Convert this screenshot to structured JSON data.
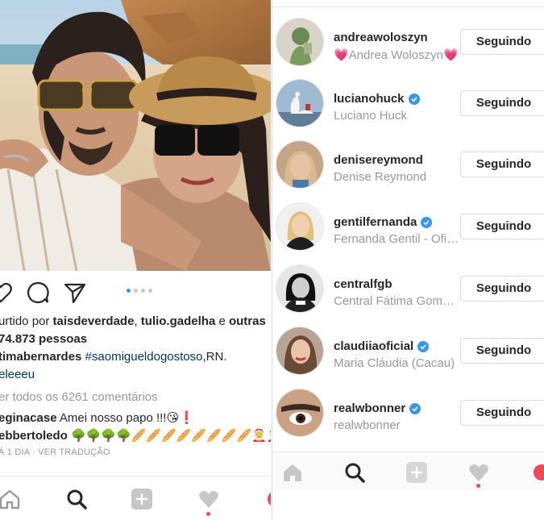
{
  "post": {
    "liked_prefix": "urtido por ",
    "liked_user1": "taisdeverdade",
    "liked_sep": ", ",
    "liked_user2": "tulio.gadelha",
    "liked_and": " e ",
    "liked_others": "outras",
    "likes_count": "74.873 pessoas",
    "caption_user": "tima­bernardes",
    "caption_hashtag": "#saomigueldogostoso",
    "caption_rest": ",RN.",
    "caption_line2": "eleeeu",
    "view_comments": "er todos os 6261 comentários",
    "comment1_user": "eginacase",
    "comment1_text": " Amei nosso papo !!!😘❗",
    "comment2_user": "ebbertoledo",
    "comment2_text": " 🌳🌳🌳🌳🥖🥖🥖🥖🥖🥖🥖🥖🤶🤶🤶🤶",
    "meta_time": "Á 1 DIA",
    "meta_sep": " · ",
    "meta_translate": "VER TRADUÇÃO",
    "carousel": {
      "total": 4,
      "active": 1
    }
  },
  "following": [
    {
      "username": "andreawoloszyn",
      "fullname": "💗Andrea Woloszyn💗",
      "verified": false,
      "button": "Seguindo"
    },
    {
      "username": "lucianohuck",
      "fullname": "Luciano Huck",
      "verified": true,
      "button": "Seguindo"
    },
    {
      "username": "denisereymond",
      "fullname": "Denise Reymond",
      "verified": false,
      "button": "Seguindo"
    },
    {
      "username": "gentilfernanda",
      "fullname": "Fernanda Gentil - Oficial",
      "verified": true,
      "button": "Seguindo"
    },
    {
      "username": "centralfgb",
      "fullname": "Central Fátima Gomes...",
      "verified": false,
      "button": "Seguindo"
    },
    {
      "username": "claudiiaoficial",
      "fullname": "Maria Cláudia (Cacau)",
      "verified": true,
      "button": "Seguindo"
    },
    {
      "username": "realwbonner",
      "fullname": "realwbonner",
      "verified": true,
      "button": "Seguindo"
    }
  ],
  "colors": {
    "verified": "#3897f0",
    "notification": "#ed4956",
    "link": "#003569"
  }
}
